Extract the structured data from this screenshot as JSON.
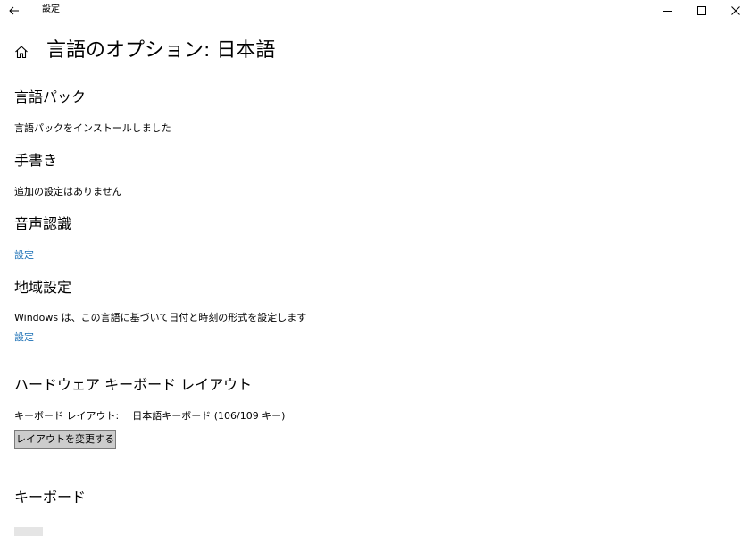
{
  "window": {
    "title": "設定",
    "controls": {
      "minimize": "minimize-icon",
      "maximize": "maximize-icon",
      "close": "close-icon"
    }
  },
  "page": {
    "title": "言語のオプション: 日本語",
    "home_icon": "home-icon"
  },
  "sections": {
    "language_pack": {
      "heading": "言語パック",
      "status": "言語パックをインストールしました"
    },
    "handwriting": {
      "heading": "手書き",
      "status": "追加の設定はありません"
    },
    "speech": {
      "heading": "音声認識",
      "link": "設定"
    },
    "regional": {
      "heading": "地域設定",
      "description": "Windows は、この言語に基づいて日付と時刻の形式を設定します",
      "link": "設定"
    },
    "hardware_keyboard": {
      "heading": "ハードウェア キーボード レイアウト",
      "layout_label": "キーボード レイアウト:",
      "layout_value": "日本語キーボード (106/109 キー)",
      "change_button": "レイアウトを変更する"
    },
    "keyboard": {
      "heading": "キーボード"
    }
  },
  "colors": {
    "link": "#1a6fb5",
    "button_bg": "#cccccc",
    "button_border": "#7a7a7a"
  }
}
